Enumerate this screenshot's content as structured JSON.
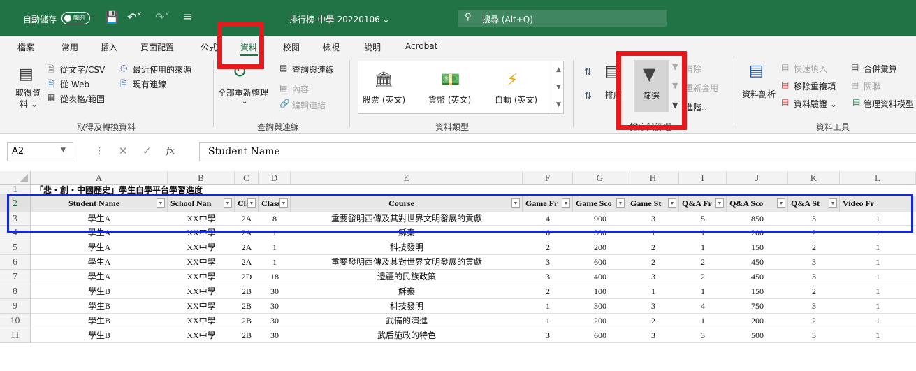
{
  "titlebar": {
    "autosave_label": "自動儲存",
    "autosave_state": "關閉",
    "doc_title": "排行榜-中學-20220106 ⌄",
    "search_placeholder": "搜尋 (Alt+Q)"
  },
  "menu": {
    "tabs": [
      "檔案",
      "常用",
      "插入",
      "頁面配置",
      "公式",
      "資料",
      "校閱",
      "檢視",
      "說明",
      "Acrobat"
    ],
    "active": "資料"
  },
  "ribbon": {
    "get_data": {
      "label_line1": "取得資",
      "label_line2": "料 ⌄",
      "from_text_csv": "從文字/CSV",
      "from_web": "從 Web",
      "from_table_range": "從表格/範圍",
      "recent_sources": "最近使用的來源",
      "existing_connections": "現有連線",
      "group_label": "取得及轉換資料"
    },
    "queries": {
      "refresh_all": "全部重新整理",
      "refresh_all_arrow": "⌄",
      "queries_connections": "查詢與連線",
      "properties": "內容",
      "edit_links": "編輯連結",
      "group_label": "查詢與連線"
    },
    "data_types": {
      "stocks": "股票 (英文)",
      "currencies": "貨幣 (英文)",
      "automatic": "自動 (英文)",
      "group_label": "資料類型"
    },
    "sort_filter": {
      "sort": "排序",
      "sort_cut": "排序",
      "filter": "篩選",
      "clear": "清除",
      "reapply": "重新套用",
      "advanced": "進階...",
      "group_label": "排序與篩選"
    },
    "data_tools": {
      "text_to_columns": "資料剖析",
      "flash_fill": "快速填入",
      "remove_duplicates": "移除重複項",
      "data_validation": "資料驗證 ⌄",
      "consolidate": "合併彙算",
      "relationships": "關聯",
      "manage_data_model": "管理資料模型",
      "group_label": "資料工具"
    }
  },
  "formula_bar": {
    "name_box": "A2",
    "fx": "fx",
    "content": "Student Name"
  },
  "sheet": {
    "columns": [
      "A",
      "B",
      "C",
      "D",
      "E",
      "F",
      "G",
      "H",
      "I",
      "J",
      "K",
      "L"
    ],
    "row_numbers": [
      "1",
      "2",
      "3",
      "4",
      "5",
      "6",
      "7",
      "8",
      "9",
      "10",
      "11"
    ],
    "title": "「悲・創・中國歷史」學生自學平台學習進度",
    "headers": [
      "Student Name",
      "School Nan",
      "Cla",
      "Class N",
      "Course",
      "Game Fr",
      "Game Sco",
      "Game St",
      "Q&A Fr",
      "Q&A Sco",
      "Q&A St",
      "Video Fr"
    ],
    "rows": [
      [
        "學生A",
        "XX中學",
        "2A",
        "8",
        "重要發明西傳及其對世界文明發展的貢獻",
        "4",
        "900",
        "3",
        "5",
        "850",
        "3",
        "1"
      ],
      [
        "學生A",
        "XX中學",
        "2A",
        "1",
        "穌秦",
        "6",
        "300",
        "1",
        "1",
        "200",
        "2",
        "1"
      ],
      [
        "學生A",
        "XX中學",
        "2A",
        "1",
        "科技發明",
        "2",
        "200",
        "2",
        "1",
        "150",
        "2",
        "1"
      ],
      [
        "學生A",
        "XX中學",
        "2A",
        "1",
        "重要發明西傳及其對世界文明發展的貢獻",
        "3",
        "600",
        "2",
        "2",
        "450",
        "3",
        "1"
      ],
      [
        "學生A",
        "XX中學",
        "2D",
        "18",
        "邊疆的民族政策",
        "3",
        "400",
        "3",
        "2",
        "450",
        "3",
        "1"
      ],
      [
        "學生B",
        "XX中學",
        "2B",
        "30",
        "穌秦",
        "2",
        "100",
        "1",
        "1",
        "150",
        "2",
        "1"
      ],
      [
        "學生B",
        "XX中學",
        "2B",
        "30",
        "科技發明",
        "1",
        "300",
        "3",
        "4",
        "750",
        "3",
        "1"
      ],
      [
        "學生B",
        "XX中學",
        "2B",
        "30",
        "武備的演進",
        "1",
        "200",
        "2",
        "1",
        "200",
        "2",
        "1"
      ],
      [
        "學生B",
        "XX中學",
        "2B",
        "30",
        "武后施政的特色",
        "3",
        "600",
        "3",
        "3",
        "500",
        "3",
        "1"
      ]
    ]
  },
  "colors": {
    "excel_green": "#217346",
    "highlight_red": "#e8191c",
    "highlight_blue": "#1428d8"
  }
}
